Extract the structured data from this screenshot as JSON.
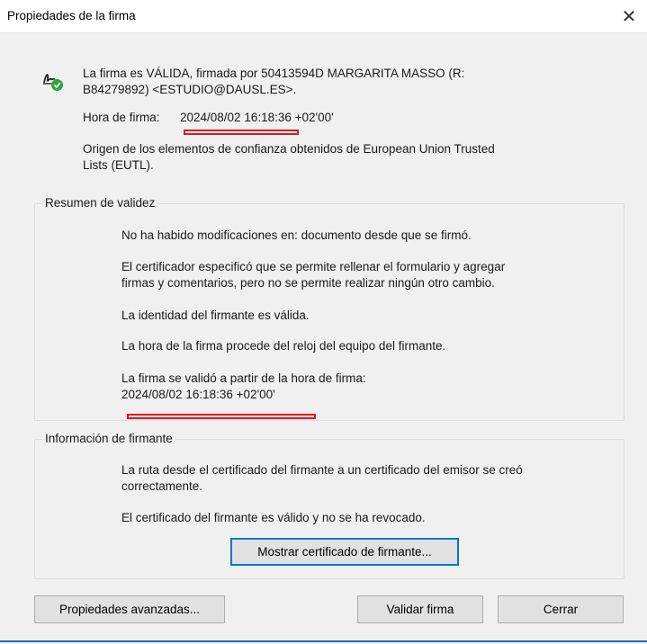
{
  "window": {
    "title": "Propiedades de la firma",
    "close_glyph": "✕"
  },
  "header": {
    "status_line": "La firma es VÁLIDA, firmada por 50413594D MARGARITA MASSO (R:",
    "status_line2": "B84279892) <ESTUDIO@DAUSL.ES>.",
    "signing_time_label": "Hora de firma:",
    "signing_time_value": "2024/08/02 16:18:36 +02'00'",
    "trust_line1": "Origen de los elementos de confianza obtenidos de European Union Trusted",
    "trust_line2": "Lists (EUTL).",
    "icon": "signature-valid-icon"
  },
  "validity_summary": {
    "label": "Resumen de validez",
    "items": [
      [
        "No ha habido modificaciones en: documento desde que se firmó."
      ],
      [
        "El certificador especificó que se permite rellenar el formulario y agregar",
        "firmas y comentarios, pero no se permite realizar ningún otro cambio."
      ],
      [
        "La identidad del firmante es válida."
      ],
      [
        "La hora de la firma procede del reloj del equipo del firmante."
      ],
      [
        "La firma se validó a partir de la hora de firma:",
        "2024/08/02 16:18:36 +02'00'"
      ]
    ]
  },
  "signer_info": {
    "label": "Información de firmante",
    "items": [
      [
        "La ruta desde el certificado del firmante a un certificado del emisor se creó",
        "correctamente."
      ],
      [
        "El certificado del firmante es válido y no se ha revocado."
      ]
    ],
    "show_cert_button": "Mostrar certificado de firmante..."
  },
  "footer": {
    "advanced_button": "Propiedades avanzadas...",
    "validate_button": "Validar firma",
    "close_button": "Cerrar"
  },
  "colors": {
    "accent": "#0078d7",
    "highlight": "#e0161d",
    "check": "#2aa63b"
  }
}
